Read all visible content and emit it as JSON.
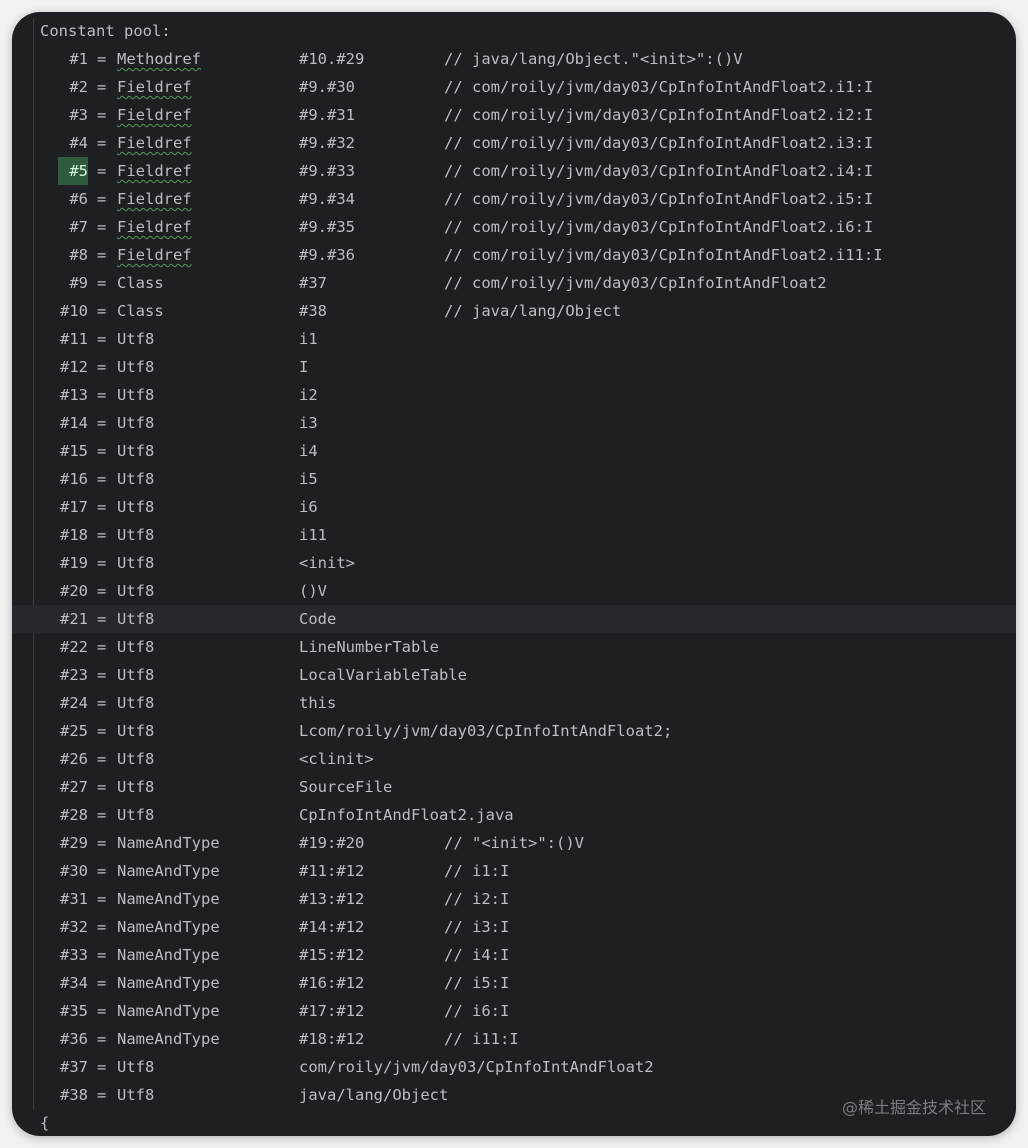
{
  "editor": {
    "header": "Constant pool:",
    "closing_brace": "{",
    "watermark": "@稀土掘金技术社区",
    "highlighted_row": "#21",
    "marked_index": "#5"
  },
  "entries": [
    {
      "idx": "#1",
      "type": "Methodref",
      "value": "#10.#29",
      "comment": "// java/lang/Object.\"<init>\":()V"
    },
    {
      "idx": "#2",
      "type": "Fieldref",
      "value": "#9.#30",
      "comment": "// com/roily/jvm/day03/CpInfoIntAndFloat2.i1:I"
    },
    {
      "idx": "#3",
      "type": "Fieldref",
      "value": "#9.#31",
      "comment": "// com/roily/jvm/day03/CpInfoIntAndFloat2.i2:I"
    },
    {
      "idx": "#4",
      "type": "Fieldref",
      "value": "#9.#32",
      "comment": "// com/roily/jvm/day03/CpInfoIntAndFloat2.i3:I"
    },
    {
      "idx": "#5",
      "type": "Fieldref",
      "value": "#9.#33",
      "comment": "// com/roily/jvm/day03/CpInfoIntAndFloat2.i4:I"
    },
    {
      "idx": "#6",
      "type": "Fieldref",
      "value": "#9.#34",
      "comment": "// com/roily/jvm/day03/CpInfoIntAndFloat2.i5:I"
    },
    {
      "idx": "#7",
      "type": "Fieldref",
      "value": "#9.#35",
      "comment": "// com/roily/jvm/day03/CpInfoIntAndFloat2.i6:I"
    },
    {
      "idx": "#8",
      "type": "Fieldref",
      "value": "#9.#36",
      "comment": "// com/roily/jvm/day03/CpInfoIntAndFloat2.i11:I"
    },
    {
      "idx": "#9",
      "type": "Class",
      "value": "#37",
      "comment": "// com/roily/jvm/day03/CpInfoIntAndFloat2"
    },
    {
      "idx": "#10",
      "type": "Class",
      "value": "#38",
      "comment": "// java/lang/Object"
    },
    {
      "idx": "#11",
      "type": "Utf8",
      "value": "i1",
      "comment": ""
    },
    {
      "idx": "#12",
      "type": "Utf8",
      "value": "I",
      "comment": ""
    },
    {
      "idx": "#13",
      "type": "Utf8",
      "value": "i2",
      "comment": ""
    },
    {
      "idx": "#14",
      "type": "Utf8",
      "value": "i3",
      "comment": ""
    },
    {
      "idx": "#15",
      "type": "Utf8",
      "value": "i4",
      "comment": ""
    },
    {
      "idx": "#16",
      "type": "Utf8",
      "value": "i5",
      "comment": ""
    },
    {
      "idx": "#17",
      "type": "Utf8",
      "value": "i6",
      "comment": ""
    },
    {
      "idx": "#18",
      "type": "Utf8",
      "value": "i11",
      "comment": ""
    },
    {
      "idx": "#19",
      "type": "Utf8",
      "value": "<init>",
      "comment": ""
    },
    {
      "idx": "#20",
      "type": "Utf8",
      "value": "()V",
      "comment": ""
    },
    {
      "idx": "#21",
      "type": "Utf8",
      "value": "Code",
      "comment": ""
    },
    {
      "idx": "#22",
      "type": "Utf8",
      "value": "LineNumberTable",
      "comment": ""
    },
    {
      "idx": "#23",
      "type": "Utf8",
      "value": "LocalVariableTable",
      "comment": ""
    },
    {
      "idx": "#24",
      "type": "Utf8",
      "value": "this",
      "comment": ""
    },
    {
      "idx": "#25",
      "type": "Utf8",
      "value": "Lcom/roily/jvm/day03/CpInfoIntAndFloat2;",
      "comment": ""
    },
    {
      "idx": "#26",
      "type": "Utf8",
      "value": "<clinit>",
      "comment": ""
    },
    {
      "idx": "#27",
      "type": "Utf8",
      "value": "SourceFile",
      "comment": ""
    },
    {
      "idx": "#28",
      "type": "Utf8",
      "value": "CpInfoIntAndFloat2.java",
      "comment": ""
    },
    {
      "idx": "#29",
      "type": "NameAndType",
      "value": "#19:#20",
      "comment": "// \"<init>\":()V"
    },
    {
      "idx": "#30",
      "type": "NameAndType",
      "value": "#11:#12",
      "comment": "// i1:I"
    },
    {
      "idx": "#31",
      "type": "NameAndType",
      "value": "#13:#12",
      "comment": "// i2:I"
    },
    {
      "idx": "#32",
      "type": "NameAndType",
      "value": "#14:#12",
      "comment": "// i3:I"
    },
    {
      "idx": "#33",
      "type": "NameAndType",
      "value": "#15:#12",
      "comment": "// i4:I"
    },
    {
      "idx": "#34",
      "type": "NameAndType",
      "value": "#16:#12",
      "comment": "// i5:I"
    },
    {
      "idx": "#35",
      "type": "NameAndType",
      "value": "#17:#12",
      "comment": "// i6:I"
    },
    {
      "idx": "#36",
      "type": "NameAndType",
      "value": "#18:#12",
      "comment": "// i11:I"
    },
    {
      "idx": "#37",
      "type": "Utf8",
      "value": "com/roily/jvm/day03/CpInfoIntAndFloat2",
      "comment": ""
    },
    {
      "idx": "#38",
      "type": "Utf8",
      "value": "java/lang/Object",
      "comment": ""
    }
  ]
}
